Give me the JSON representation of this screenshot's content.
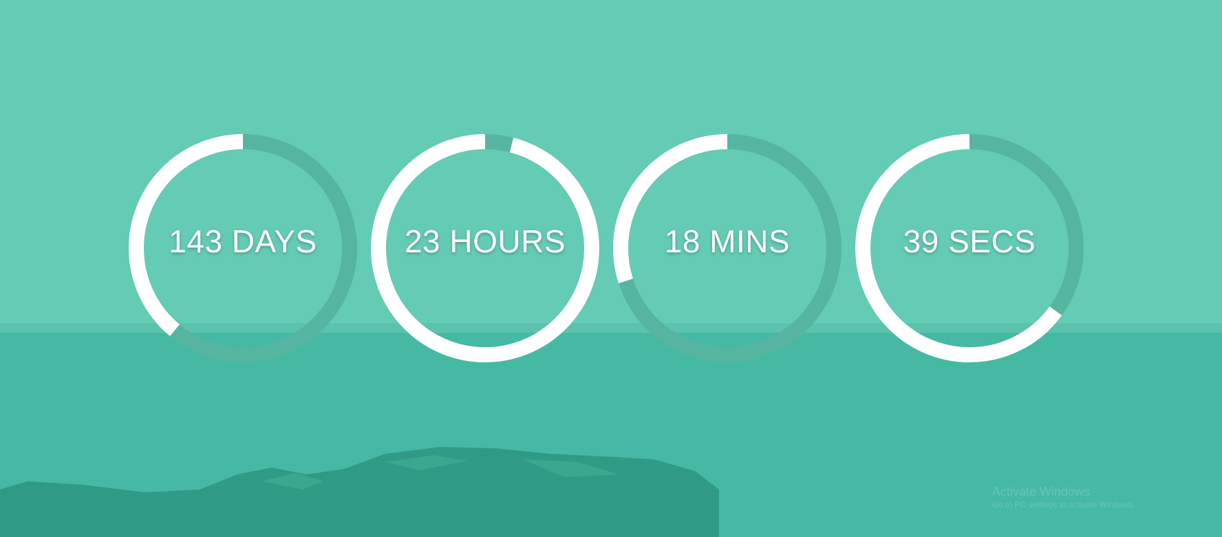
{
  "colors": {
    "background": "#64cbb4",
    "sea": "#3fb5a0",
    "rock": "#2f9b84",
    "ring_track": "#56b5a1",
    "ring_fill": "#ffffff",
    "text": "#ffffff"
  },
  "countdown": {
    "units": [
      {
        "label": "143 DAYS",
        "progress": 0.39
      },
      {
        "label": "23 HOURS",
        "progress": 0.96
      },
      {
        "label": "18 MINS",
        "progress": 0.3
      },
      {
        "label": "39 SECS",
        "progress": 0.65
      }
    ]
  },
  "watermark": {
    "title": "Activate Windows",
    "subtitle": "Go to PC settings to activate Windows."
  }
}
